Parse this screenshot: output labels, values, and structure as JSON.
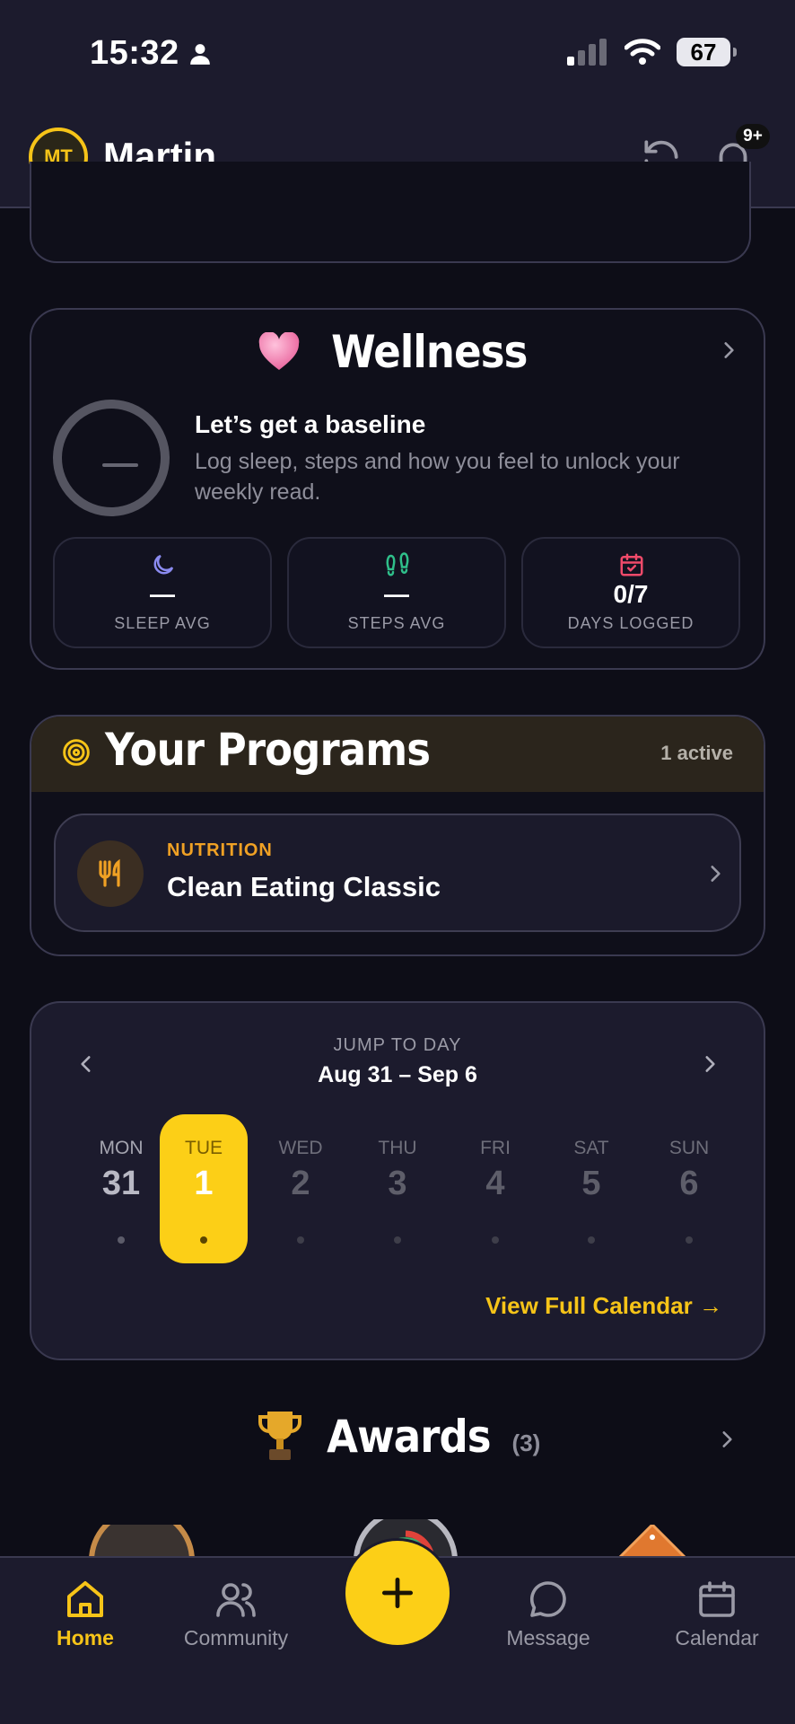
{
  "status_bar": {
    "time": "15:32",
    "battery": "67"
  },
  "header": {
    "avatar_initials": "MT",
    "user_name": "Martin",
    "notification_badge": "9+"
  },
  "wellness": {
    "title": "Wellness",
    "baseline_title": "Let’s get a baseline",
    "baseline_text": "Log sleep, steps and how you feel to unlock your weekly read.",
    "stats": [
      {
        "icon": "moon-icon",
        "value": "—",
        "label": "SLEEP AVG",
        "color": "#8b8bf0"
      },
      {
        "icon": "footprints-icon",
        "value": "—",
        "label": "STEPS AVG",
        "color": "#2fbf8a"
      },
      {
        "icon": "calendar-check-icon",
        "value": "0/7",
        "label": "DAYS LOGGED",
        "color": "#f04a6a"
      }
    ]
  },
  "programs": {
    "title": "Your Programs",
    "active_count": "1 active",
    "items": [
      {
        "category": "NUTRITION",
        "name": "Clean Eating Classic",
        "icon": "fork-knife-icon"
      }
    ]
  },
  "calendar": {
    "jump_label": "JUMP TO DAY",
    "range": "Aug 31 – Sep 6",
    "days": [
      {
        "name": "MON",
        "num": "31"
      },
      {
        "name": "TUE",
        "num": "1",
        "selected": true
      },
      {
        "name": "WED",
        "num": "2"
      },
      {
        "name": "THU",
        "num": "3"
      },
      {
        "name": "FRI",
        "num": "4"
      },
      {
        "name": "SAT",
        "num": "5"
      },
      {
        "name": "SUN",
        "num": "6"
      }
    ],
    "view_full": "View Full Calendar →"
  },
  "awards": {
    "title": "Awards",
    "count": "(3)"
  },
  "nav": {
    "items": [
      {
        "label": "Home",
        "icon": "home-icon",
        "active": true
      },
      {
        "label": "Community",
        "icon": "users-icon"
      },
      {
        "label": "Message",
        "icon": "chat-icon"
      },
      {
        "label": "Calendar",
        "icon": "calendar-icon"
      }
    ],
    "fab_icon": "plus-icon"
  },
  "colors": {
    "accent": "#fccf17",
    "background": "#0d0d17",
    "card": "#1c1b2d",
    "orange": "#f0a124"
  }
}
